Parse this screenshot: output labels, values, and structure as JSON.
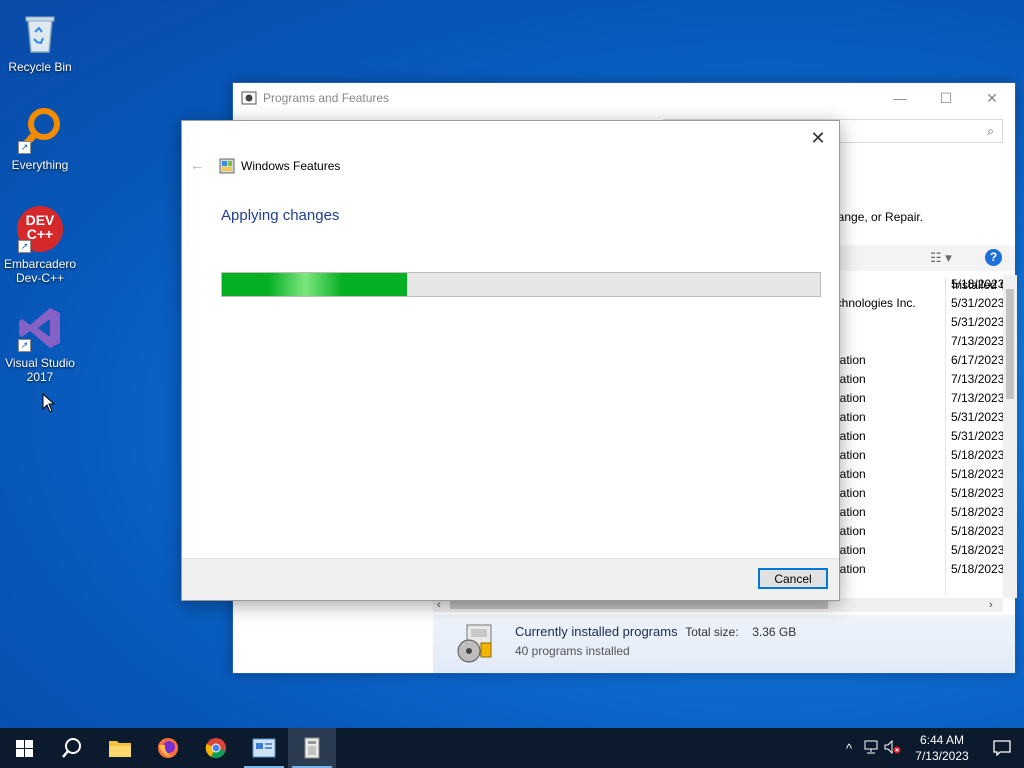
{
  "desktop": {
    "icons": [
      {
        "label": "Recycle Bin"
      },
      {
        "label": "Everything"
      },
      {
        "label": "Embarcadero Dev-C++",
        "art": "DEV\nC++"
      },
      {
        "label": "Visual Studio 2017"
      }
    ]
  },
  "pf_window": {
    "title": "Programs and Features",
    "controls": {
      "minimize": "—",
      "maximize": "☐",
      "close": "✕"
    },
    "search_icon": "⌕",
    "description_tail": "hange, or Repair.",
    "help": "?",
    "column_header": "Installed On",
    "rows": [
      {
        "publisher": "",
        "date": "5/18/2023"
      },
      {
        "publisher": "echnologies Inc.",
        "date": "5/31/2023"
      },
      {
        "publisher": "",
        "date": "5/31/2023"
      },
      {
        "publisher": "",
        "date": "7/13/2023"
      },
      {
        "publisher": "oration",
        "date": "6/17/2023"
      },
      {
        "publisher": "oration",
        "date": "7/13/2023"
      },
      {
        "publisher": "oration",
        "date": "7/13/2023"
      },
      {
        "publisher": "oration",
        "date": "5/31/2023"
      },
      {
        "publisher": "oration",
        "date": "5/31/2023"
      },
      {
        "publisher": "oration",
        "date": "5/18/2023"
      },
      {
        "publisher": "oration",
        "date": "5/18/2023"
      },
      {
        "publisher": "oration",
        "date": "5/18/2023"
      },
      {
        "publisher": "oration",
        "date": "5/18/2023"
      },
      {
        "publisher": "oration",
        "date": "5/18/2023"
      },
      {
        "publisher": "oration",
        "date": "5/18/2023"
      },
      {
        "publisher": "oration",
        "date": "5/18/2023"
      }
    ],
    "status": {
      "title": "Currently installed programs",
      "total_size_label": "Total size:",
      "total_size_value": "3.36 GB",
      "count": "40 programs installed"
    }
  },
  "wf_dialog": {
    "title": "Windows Features",
    "heading": "Applying changes",
    "progress": 0.31,
    "cancel_label": "Cancel",
    "close": "✕",
    "back": "←"
  },
  "taskbar": {
    "time": "6:44 AM",
    "date": "7/13/2023",
    "tray_up": "^",
    "accent": "#76b9ed"
  }
}
